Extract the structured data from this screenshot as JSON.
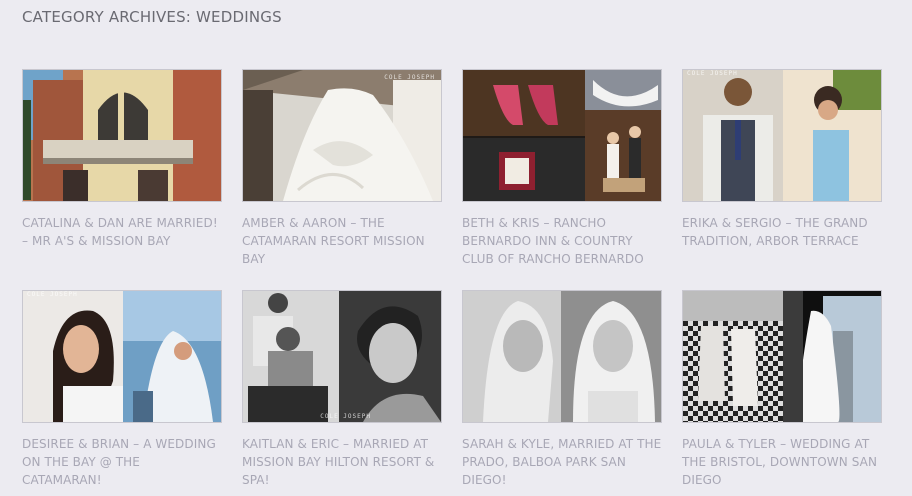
{
  "archive": {
    "title": "CATEGORY ARCHIVES: WEDDINGS"
  },
  "posts": [
    {
      "caption": "CATALINA & DAN ARE MARRIED! – MR A'S & MISSION BAY",
      "thumb": "catalina-dan-thumbnail"
    },
    {
      "caption": "AMBER & AARON – THE CATAMARAN RESORT MISSION BAY",
      "thumb": "amber-aaron-thumbnail",
      "watermark": "COLE JOSEPH"
    },
    {
      "caption": "BETH & KRIS – RANCHO BERNARDO INN & COUNTRY CLUB OF RANCHO BERNARDO",
      "thumb": "beth-kris-thumbnail"
    },
    {
      "caption": "ERIKA & SERGIO – THE GRAND TRADITION, ARBOR TERRACE",
      "thumb": "erika-sergio-thumbnail",
      "watermark": "COLE JOSEPH"
    },
    {
      "caption": "DESIREE & BRIAN – A WEDDING ON THE BAY @ THE CATAMARAN!",
      "thumb": "desiree-brian-thumbnail",
      "watermark": "COLE JOSEPH"
    },
    {
      "caption": "KAITLAN & ERIC – MARRIED AT MISSION BAY HILTON RESORT & SPA!",
      "thumb": "kaitlan-eric-thumbnail",
      "watermark": "COLE JOSEPH"
    },
    {
      "caption": "SARAH & KYLE, MARRIED AT THE PRADO, BALBOA PARK SAN DIEGO!",
      "thumb": "sarah-kyle-thumbnail"
    },
    {
      "caption": "PAULA & TYLER – WEDDING AT THE BRISTOL, DOWNTOWN SAN DIEGO",
      "thumb": "paula-tyler-thumbnail"
    }
  ]
}
